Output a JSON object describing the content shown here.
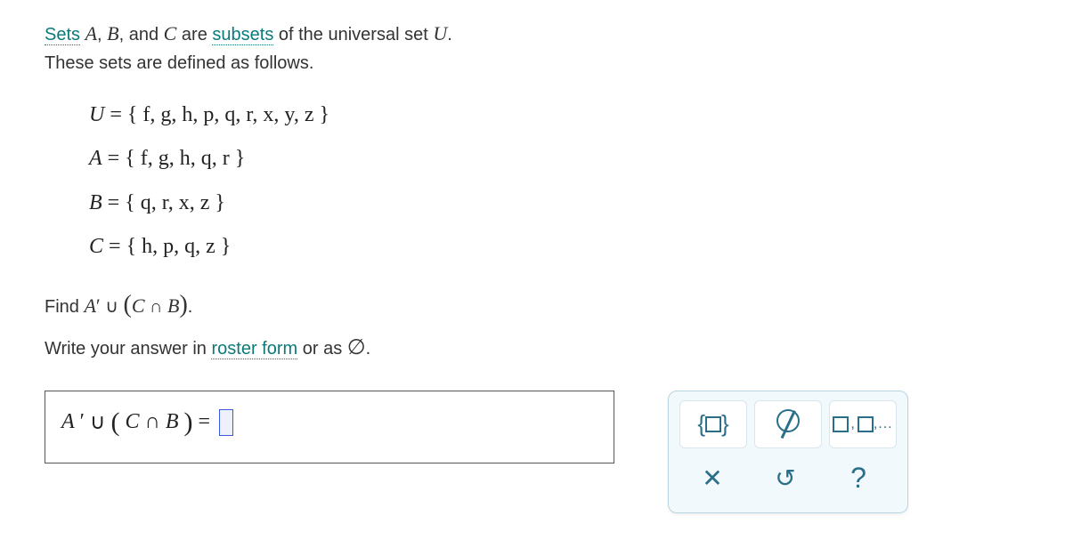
{
  "intro": {
    "sets_link": "Sets",
    "line1_part1": " ",
    "A": "A",
    "comma1": ", ",
    "B": "B",
    "comma2": ", and ",
    "C": "C",
    "line1_part2": " are ",
    "subsets_link": "subsets",
    "line1_part3": " of the universal set ",
    "U": "U",
    "line1_part4": ".",
    "line2": "These sets are defined as follows."
  },
  "defs": {
    "U_lhs": "U",
    "U_eq": " = ",
    "U_rhs": "{ f, g, h, p, q, r, x, y, z }",
    "A_lhs": "A",
    "A_eq": " = ",
    "A_rhs": "{ f, g, h, q, r }",
    "B_lhs": "B",
    "B_eq": " = ",
    "B_rhs": "{ q, r, x, z }",
    "C_lhs": "C",
    "C_eq": " = ",
    "C_rhs": "{ h, p, q, z }"
  },
  "question": {
    "find_prefix": "Find ",
    "expr_A": "A",
    "expr_prime": "′",
    "expr_union": " ∪ ",
    "expr_lparen": "(",
    "expr_C": "C",
    "expr_inter": " ∩ ",
    "expr_B": "B",
    "expr_rparen": ")",
    "expr_period": ".",
    "write_prefix": "Write your answer in ",
    "roster_link": "roster form",
    "write_suffix": " or as ",
    "empty_sym": "∅",
    "write_period": "."
  },
  "answer": {
    "A": "A",
    "prime": "′",
    "union": " ∪ ",
    "lparen": "(",
    "C": "C",
    "inter": " ∩ ",
    "B": "B",
    "rparen": ")",
    "equals": " = "
  },
  "toolbox": {
    "braces_left": "{",
    "braces_right": "}",
    "list_tail": ",...",
    "clear_label": "✕",
    "reset_label": "↺",
    "help_label": "?"
  }
}
